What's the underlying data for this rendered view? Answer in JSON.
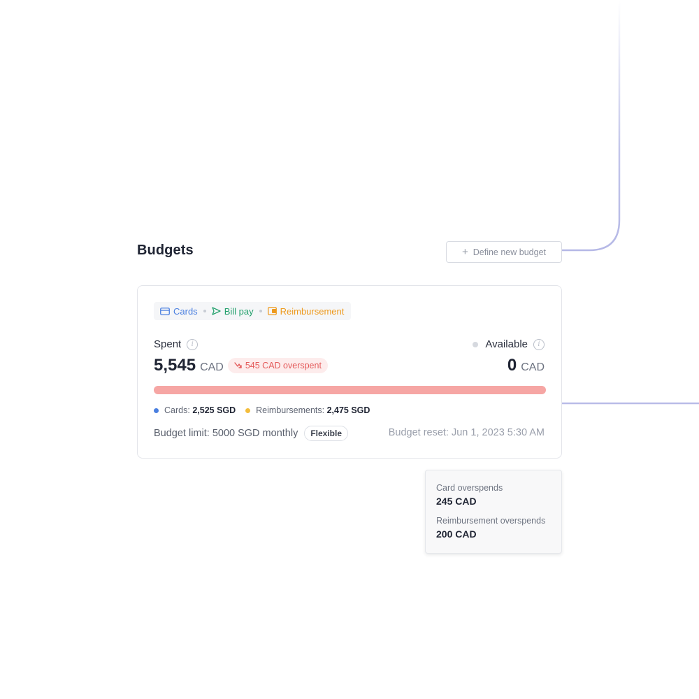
{
  "section": {
    "title": "Budgets",
    "define_button": "Define new budget",
    "define_icon": "plus-icon"
  },
  "budget_card": {
    "tags": [
      {
        "label": "Cards",
        "icon": "credit-card-icon",
        "color": "#4a7fe0"
      },
      {
        "label": "Bill pay",
        "icon": "send-icon",
        "color": "#23a06c"
      },
      {
        "label": "Reimbursement",
        "icon": "wallet-icon",
        "color": "#ee9a1e"
      }
    ],
    "spent": {
      "label": "Spent",
      "amount": "5,545",
      "currency": "CAD",
      "overspent_badge": "545 CAD overspent"
    },
    "available": {
      "label": "Available",
      "amount": "0",
      "currency": "CAD"
    },
    "progress": {
      "fraction": 1.0,
      "color": "#f6a6a4"
    },
    "breakdown": [
      {
        "label": "Cards:",
        "value": "2,525 SGD",
        "color": "#4a7fe0"
      },
      {
        "label": "Reimbursements:",
        "value": "2,475 SGD",
        "color": "#f3bd3c"
      }
    ],
    "limit_text": "Budget limit: 5000 SGD monthly",
    "limit_badge": "Flexible",
    "reset_text": "Budget reset: Jun 1, 2023 5:30 AM"
  },
  "tooltip": {
    "card_label": "Card overspends",
    "card_value": "245 CAD",
    "reimb_label": "Reimbursement overspends",
    "reimb_value": "200 CAD"
  }
}
